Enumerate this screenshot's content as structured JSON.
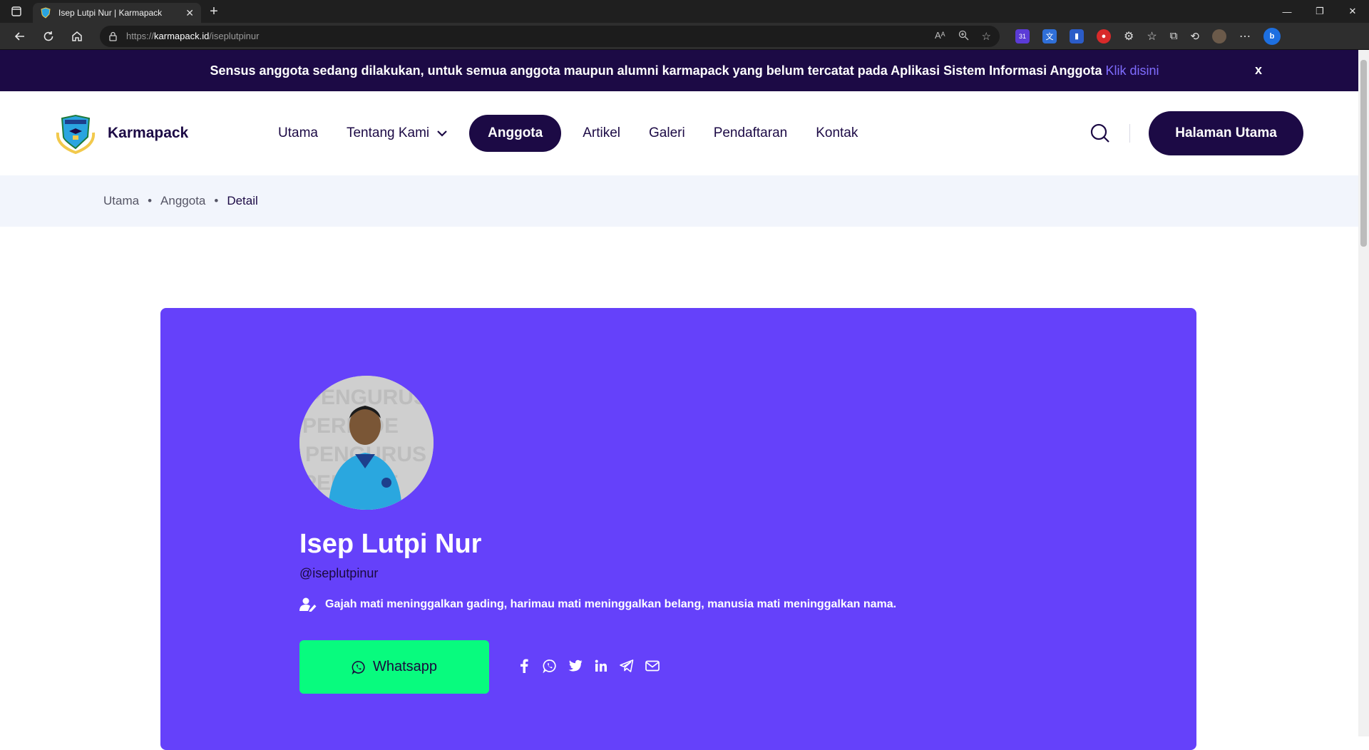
{
  "browser": {
    "tab_title": "Isep Lutpi Nur | Karmapack",
    "url_scheme": "https://",
    "url_host": "karmapack.id",
    "url_path": "/iseplutpinur",
    "ext_badge": "31"
  },
  "banner": {
    "message": "Sensus anggota sedang dilakukan, untuk semua anggota maupun alumni karmapack yang belum tercatat pada Aplikasi Sistem Informasi Anggota",
    "link_text": "Klik disini",
    "close_label": "x"
  },
  "nav": {
    "brand": "Karmapack",
    "items": [
      {
        "label": "Utama"
      },
      {
        "label": "Tentang Kami"
      },
      {
        "label": "Anggota"
      },
      {
        "label": "Artikel"
      },
      {
        "label": "Galeri"
      },
      {
        "label": "Pendaftaran"
      },
      {
        "label": "Kontak"
      }
    ],
    "cta": "Halaman Utama"
  },
  "breadcrumb": [
    "Utama",
    "Anggota",
    "Detail"
  ],
  "profile": {
    "name": "Isep Lutpi Nur",
    "handle": "@iseplutpinur",
    "bio": "Gajah mati meninggalkan gading, harimau mati meninggalkan belang, manusia mati meninggalkan nama.",
    "whatsapp_label": "Whatsapp"
  },
  "colors": {
    "navy": "#1c0a45",
    "card": "#6541fa",
    "whatsapp": "#08fb7e",
    "banner_link": "#7f6cff"
  }
}
